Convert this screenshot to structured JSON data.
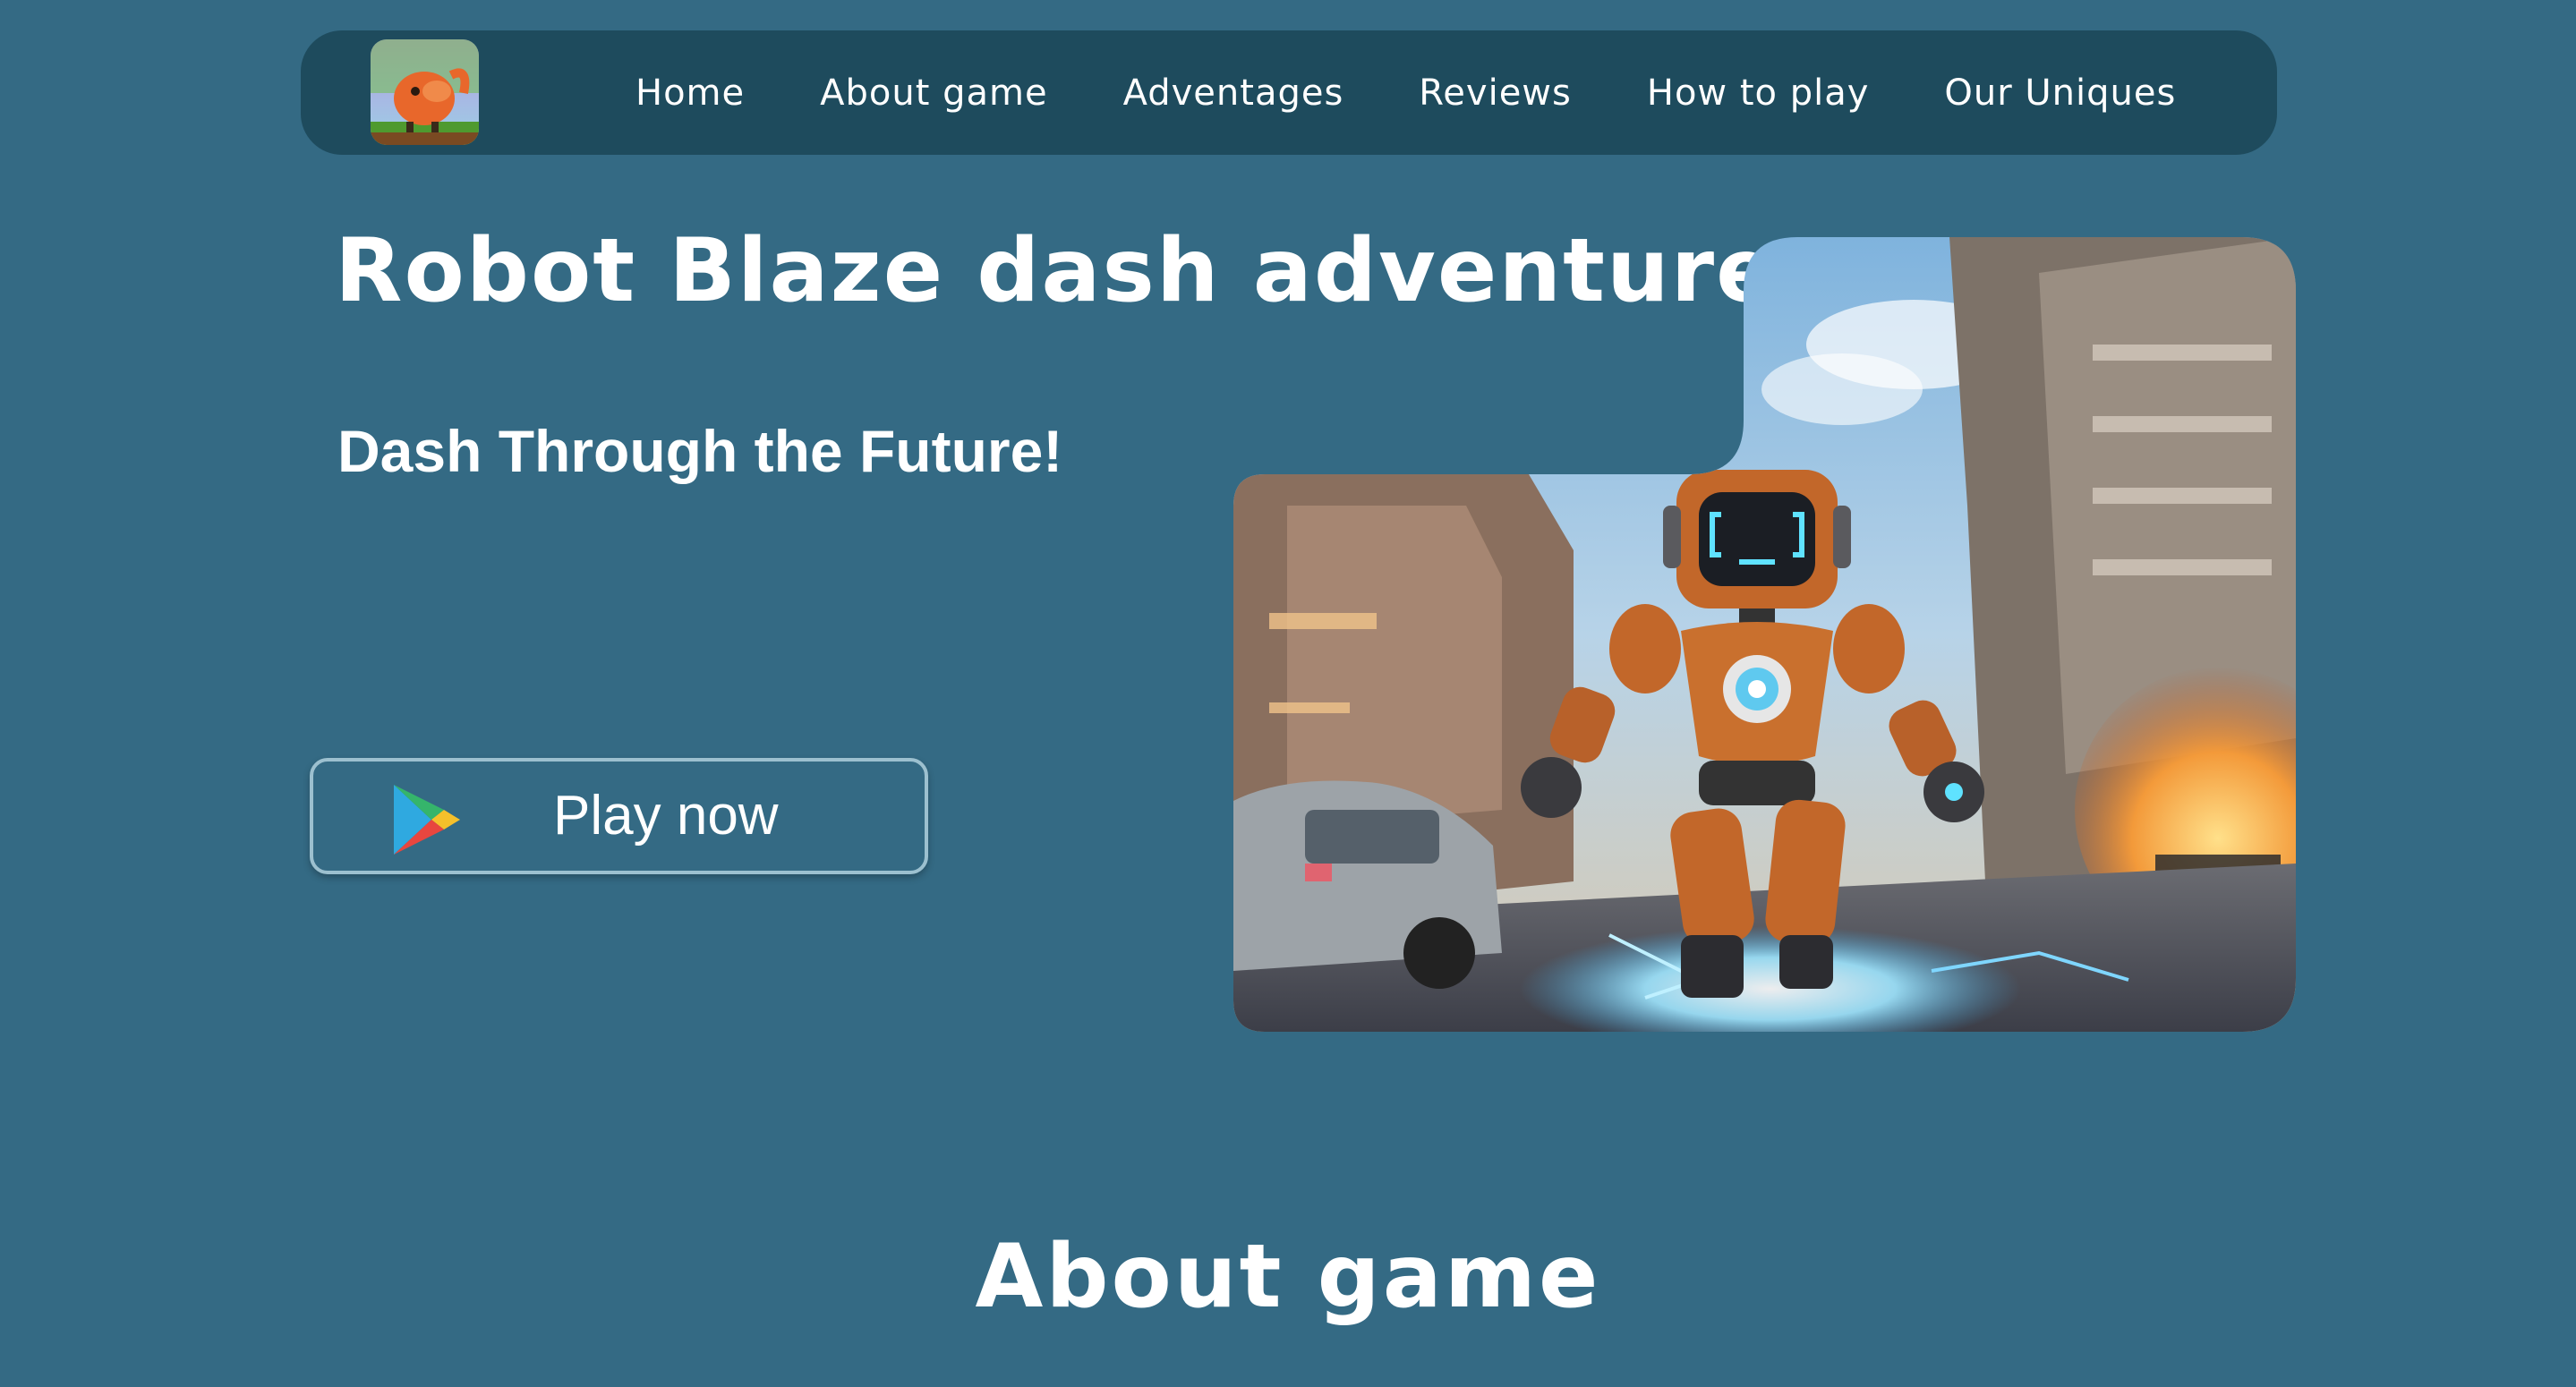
{
  "nav": {
    "logo_icon": "game-logo-icon",
    "links": [
      {
        "label": "Home"
      },
      {
        "label": "About game"
      },
      {
        "label": "Adventages"
      },
      {
        "label": "Reviews"
      },
      {
        "label": "How to play"
      },
      {
        "label": "Our Uniques"
      }
    ]
  },
  "hero": {
    "title": "Robot Blaze dash adventure",
    "subtitle": "Dash Through the Future!",
    "play_button": {
      "label": "Play now",
      "icon": "google-play-icon"
    },
    "image_icon": "robot-hero-image"
  },
  "about": {
    "title": "About game"
  },
  "colors": {
    "background": "#346a84",
    "nav_background": "#1e4b5d",
    "button_border": "#9cc0cf",
    "text": "#ffffff"
  }
}
